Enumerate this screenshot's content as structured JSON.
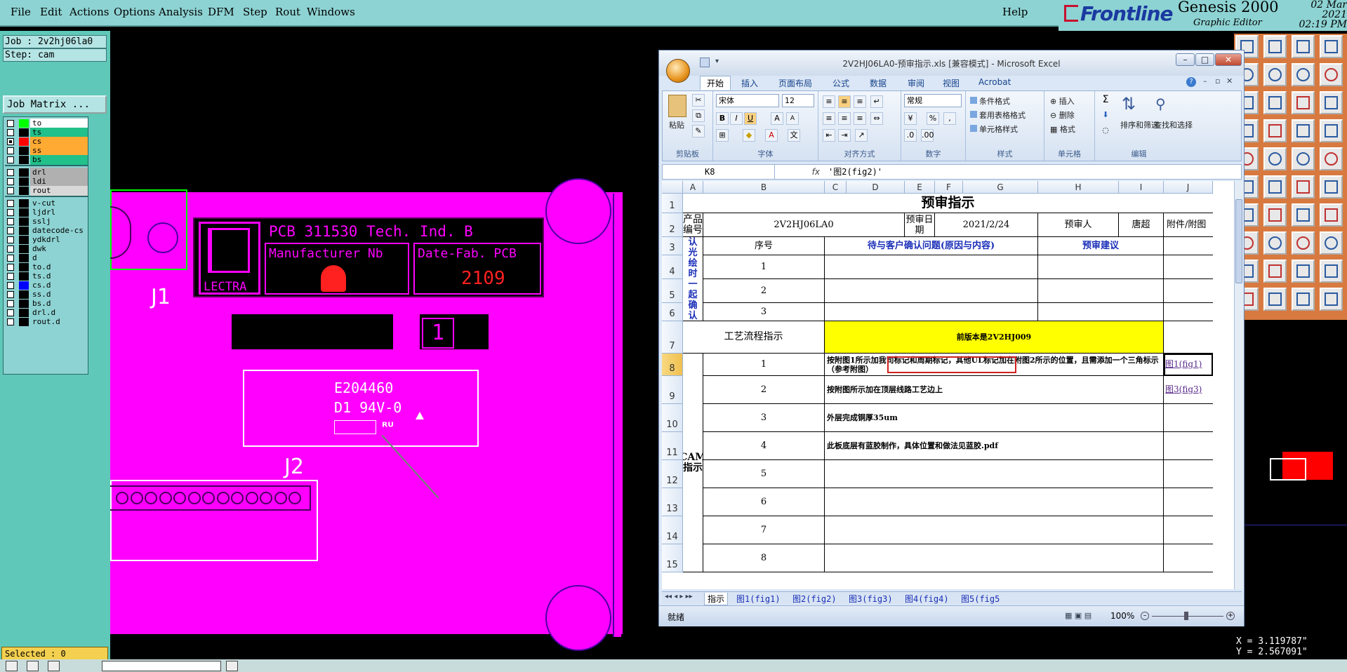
{
  "menubar": {
    "items": [
      "File",
      "Edit",
      "Actions",
      "Options",
      "Analysis",
      "DFM",
      "Step",
      "Rout",
      "Windows"
    ],
    "help": "Help"
  },
  "brand": {
    "logo": "Frontline",
    "product": "Genesis 2000",
    "subtitle": "Graphic Editor",
    "date": "02 Mar 2021",
    "time": "02:19 PM"
  },
  "job": {
    "job_line": "Job : 2v2hj06la0",
    "step_line": "Step: cam",
    "matrix_button": "Job Matrix ..."
  },
  "layers": {
    "group1": [
      {
        "name": "to",
        "color": "#00ff00",
        "bg": "#ffffff",
        "checked": false
      },
      {
        "name": "ts",
        "color": "#000000",
        "bg": "#22c08a",
        "checked": false
      },
      {
        "name": "cs",
        "color": "#ff0000",
        "bg": "#ffaa33",
        "checked": true
      },
      {
        "name": "ss",
        "color": "#000000",
        "bg": "#ffaa33",
        "checked": false
      },
      {
        "name": "bs",
        "color": "#000000",
        "bg": "#22c08a",
        "checked": false
      }
    ],
    "group2": [
      {
        "name": "drl",
        "color": "#000000",
        "bg": "#b0b0b0",
        "checked": false
      },
      {
        "name": "ldi",
        "color": "#000000",
        "bg": "#b0b0b0",
        "checked": false
      },
      {
        "name": "rout",
        "color": "#000000",
        "bg": "#d8d8d8",
        "checked": false
      }
    ],
    "group3": [
      {
        "name": "v-cut",
        "color": "#000000",
        "bg": "#8ed3d3",
        "checked": false
      },
      {
        "name": "ljdrl",
        "color": "#000000",
        "bg": "#8ed3d3",
        "checked": false
      },
      {
        "name": "sslj",
        "color": "#000000",
        "bg": "#8ed3d3",
        "checked": false
      },
      {
        "name": "datecode-cs",
        "color": "#000000",
        "bg": "#8ed3d3",
        "checked": false
      },
      {
        "name": "ydkdrl",
        "color": "#000000",
        "bg": "#8ed3d3",
        "checked": false
      },
      {
        "name": "dwk",
        "color": "#000000",
        "bg": "#8ed3d3",
        "checked": false
      },
      {
        "name": "d",
        "color": "#000000",
        "bg": "#8ed3d3",
        "checked": false
      },
      {
        "name": "to.d",
        "color": "#000000",
        "bg": "#8ed3d3",
        "checked": false
      },
      {
        "name": "ts.d",
        "color": "#000000",
        "bg": "#8ed3d3",
        "checked": false
      },
      {
        "name": "cs.d",
        "color": "#0000ff",
        "bg": "#8ed3d3",
        "checked": false
      },
      {
        "name": "ss.d",
        "color": "#000000",
        "bg": "#8ed3d3",
        "checked": false
      },
      {
        "name": "bs.d",
        "color": "#000000",
        "bg": "#8ed3d3",
        "checked": false
      },
      {
        "name": "drl.d",
        "color": "#000000",
        "bg": "#8ed3d3",
        "checked": false
      },
      {
        "name": "rout.d",
        "color": "#000000",
        "bg": "#8ed3d3",
        "checked": false
      }
    ]
  },
  "selected": "Selected : 0",
  "pcb": {
    "line1": "PCB 311530  Tech. Ind. B",
    "mfr": "Manufacturer Nb",
    "datefab": "Date-Fab. PCB",
    "datecode": "2109",
    "brand": "LECTRA",
    "box_num": "1",
    "ul_code": "E204460",
    "ul_rating": "D1 94V-0",
    "j1": "J1",
    "j2": "J2",
    "color_board": "#ff00ff"
  },
  "coords": {
    "x": "X = 3.119787\"",
    "y": "Y = 2.567091\""
  },
  "excel": {
    "title": "2V2HJ06LA0-预审指示.xls [兼容模式] - Microsoft Excel",
    "tabs": [
      "开始",
      "插入",
      "页面布局",
      "公式",
      "数据",
      "审阅",
      "视图",
      "Acrobat"
    ],
    "ribbon": {
      "paste": "粘贴",
      "clipboard": "剪贴板",
      "font_name": "宋体",
      "font_size": "12",
      "font_group": "字体",
      "align_group": "对齐方式",
      "number_format": "常规",
      "number_group": "数字",
      "cond_format": "条件格式",
      "table_format": "套用表格格式",
      "cell_style": "单元格样式",
      "style_group": "样式",
      "insert": "插入",
      "delete": "删除",
      "format": "格式",
      "cells_group": "单元格",
      "sort_filter": "排序和筛选",
      "find_select": "查找和选择",
      "edit_group": "编辑"
    },
    "namebox": "K8",
    "fx": "fx",
    "formula": "'图2(fig2)'",
    "columns": [
      "A",
      "B",
      "C",
      "D",
      "E",
      "F",
      "G",
      "H",
      "I",
      "J"
    ],
    "rows": [
      "1",
      "2",
      "3",
      "4",
      "5",
      "6",
      "7",
      "8",
      "9",
      "10",
      "11",
      "12",
      "13",
      "14",
      "15"
    ],
    "cells": {
      "title": "预审指示",
      "prod_label": "产品编号",
      "prod_value": "2V2HJ06LA0",
      "pre_date_label": "预审日期",
      "pre_date_value": "2021/2/24",
      "reviewer_label": "预审人",
      "reviewer_value": "唐超",
      "attach_label": "附件/附图",
      "pending_label": "待确认光绘时一起确认问题",
      "seq_label": "序号",
      "issue_label": "待与客户确认问题(原因与内容)",
      "suggest_label": "预审建议",
      "row4": "1",
      "row5": "2",
      "row6": "3",
      "process_label": "工艺流程指示",
      "process_value": "前版本是2V2HJ009",
      "cam_label": "CAM指示",
      "cam_rows": [
        {
          "n": "1",
          "text": "按附图1所示加我司标记和周期标记，其他UL标记加在附图2所示的位置，且需添加一个三角标示（参考附图）",
          "link": "图1(fig1)"
        },
        {
          "n": "2",
          "text": "按附图所示加在顶层线路工艺边上",
          "link": "图3(fig3)"
        },
        {
          "n": "3",
          "text": "外层完成铜厚35um",
          "link": ""
        },
        {
          "n": "4",
          "text": "此板底层有蓝胶制作，具体位置和做法见蓝胶.pdf",
          "link": ""
        },
        {
          "n": "5",
          "text": "",
          "link": ""
        },
        {
          "n": "6",
          "text": "",
          "link": ""
        },
        {
          "n": "7",
          "text": "",
          "link": ""
        },
        {
          "n": "8",
          "text": "",
          "link": ""
        }
      ]
    },
    "sheet_tabs": [
      "指示",
      "图1(fig1)",
      "图2(fig2)",
      "图3(fig3)",
      "图4(fig4)",
      "图5(fig5"
    ],
    "status_ready": "就绪",
    "zoom": "100%"
  }
}
